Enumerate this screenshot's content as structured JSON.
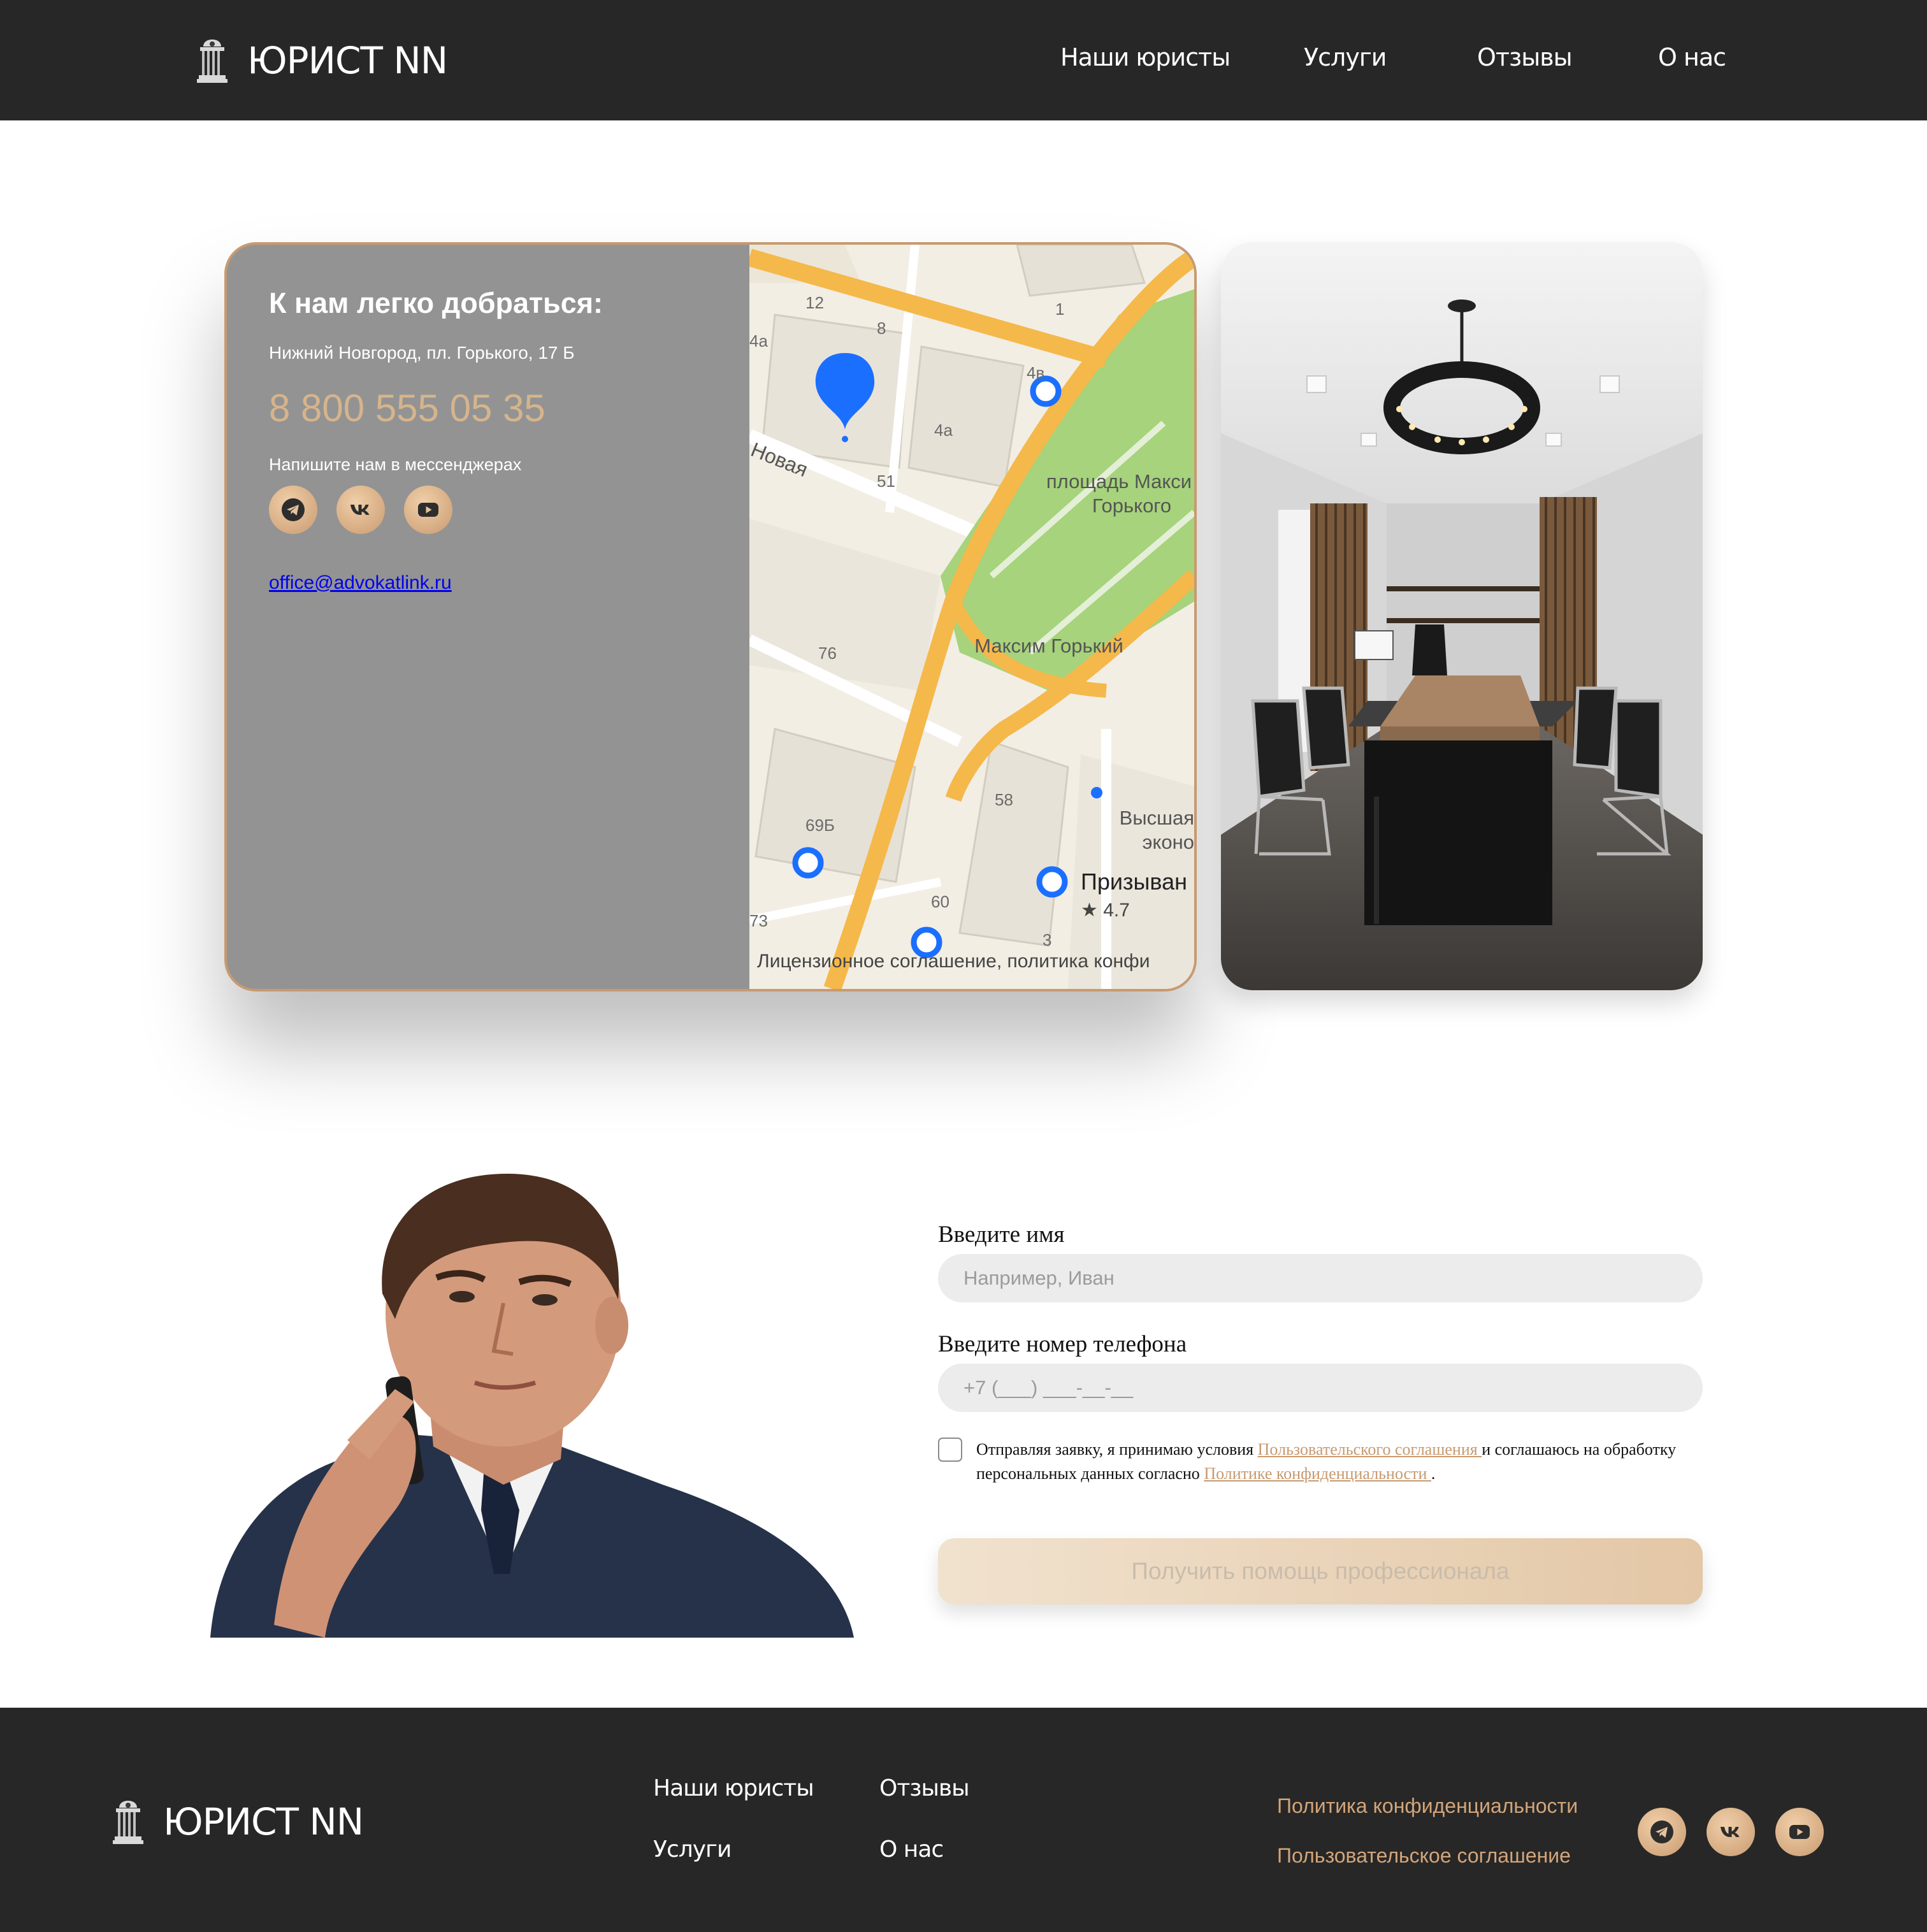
{
  "header": {
    "logo_text": "ЮРИСТ NN",
    "nav": [
      "Наши юристы",
      "Услуги",
      "Отзывы",
      "О нас"
    ]
  },
  "contact_card": {
    "title": "К нам легко добраться:",
    "address": "Нижний Новгород, пл. Горького, 17 Б",
    "phone": "8 800 555 05 35",
    "messengers_label": "Напишите нам в мессенджерах",
    "socials": [
      "telegram-icon",
      "vk-icon",
      "youtube-icon"
    ],
    "email": "office@advokatlink.ru"
  },
  "map": {
    "street": "Новая",
    "square": "площадь Макси Горького",
    "monument": "Максим Горький",
    "place_name": "Призыван",
    "rating": "★ 4.7",
    "higher": "Высшая",
    "econ": "эконо",
    "house_numbers": [
      "12",
      "8",
      "1",
      "4а",
      "4в",
      "4а",
      "51",
      "76",
      "69Б",
      "58",
      "60",
      "73",
      "3"
    ],
    "attribution": "Лицензионное соглашение, политика конфи"
  },
  "form": {
    "name_label": "Введите имя",
    "name_placeholder": "Например, Иван",
    "phone_label": "Введите номер телефона",
    "phone_placeholder": "+7 (___) ___-__-__",
    "consent_before": "Отправляя заявку, я принимаю условия ",
    "consent_link1": "Пользовательского соглашения ",
    "consent_mid": " и соглашаюсь на обработку персональных данных согласно ",
    "consent_link2": "Политике конфиденциальности ",
    "consent_after": ".",
    "submit": "Получить помощь профессионала"
  },
  "footer": {
    "logo_text": "ЮРИСТ NN",
    "links": [
      "Наши юристы",
      "Отзывы",
      "Услуги",
      "О нас"
    ],
    "privacy": "Политика конфиденциальности",
    "agreement": "Пользовательское соглашение",
    "socials": [
      "telegram-icon",
      "vk-icon",
      "youtube-icon"
    ]
  },
  "colors": {
    "dark": "#272727",
    "accent": "#c79a71",
    "card_grey": "#939393",
    "phone": "#d6b48c"
  }
}
